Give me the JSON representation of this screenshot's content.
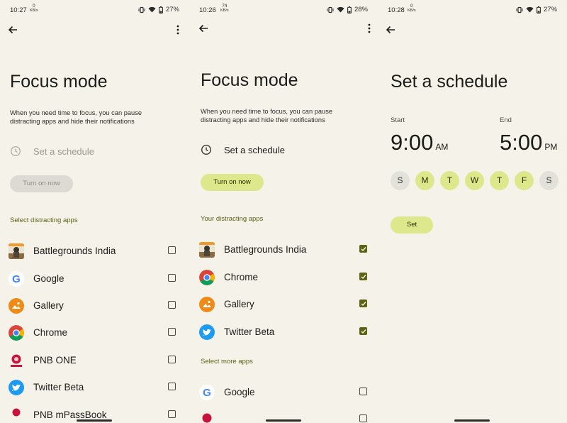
{
  "colors": {
    "background": "#f5f2ea",
    "accent": "#dde88c",
    "accent_text": "#2a2f00",
    "disabled": "#dcdad2",
    "section_text": "#5b6112",
    "checkbox_on": "#5c6312",
    "day_off": "#e3e2da"
  },
  "screen1": {
    "status": {
      "time": "10:27",
      "kb_value": "0",
      "kb_unit": "KB/s",
      "battery": "27%"
    },
    "title": "Focus mode",
    "description": "When you need time to focus, you can pause distracting apps and hide their notifications",
    "schedule_label": "Set a schedule",
    "turn_on_label": "Turn on now",
    "section_label": "Select distracting apps",
    "apps": [
      {
        "name": "Battlegrounds India",
        "checked": false,
        "icon": "battlegrounds-icon"
      },
      {
        "name": "Google",
        "checked": false,
        "icon": "google-icon"
      },
      {
        "name": "Gallery",
        "checked": false,
        "icon": "gallery-icon"
      },
      {
        "name": "Chrome",
        "checked": false,
        "icon": "chrome-icon"
      },
      {
        "name": "PNB ONE",
        "checked": false,
        "icon": "pnb-one-icon"
      },
      {
        "name": "Twitter Beta",
        "checked": false,
        "icon": "twitter-icon"
      },
      {
        "name": "PNB mPassBook",
        "checked": false,
        "icon": "pnb-mpassbook-icon"
      }
    ]
  },
  "screen2": {
    "status": {
      "time": "10:26",
      "kb_value": "74",
      "kb_unit": "KB/s",
      "battery": "28%"
    },
    "title": "Focus mode",
    "description": "When you need time to focus, you can pause distracting apps and hide their notifications",
    "schedule_label": "Set a schedule",
    "turn_on_label": "Turn on now",
    "section_label": "Your distracting apps",
    "apps": [
      {
        "name": "Battlegrounds India",
        "checked": true,
        "icon": "battlegrounds-icon"
      },
      {
        "name": "Chrome",
        "checked": true,
        "icon": "chrome-icon"
      },
      {
        "name": "Gallery",
        "checked": true,
        "icon": "gallery-icon"
      },
      {
        "name": "Twitter Beta",
        "checked": true,
        "icon": "twitter-icon"
      }
    ],
    "more_section_label": "Select more apps",
    "more_apps": [
      {
        "name": "Google",
        "checked": false,
        "icon": "google-icon"
      }
    ]
  },
  "screen3": {
    "status": {
      "time": "10:28",
      "kb_value": "0",
      "kb_unit": "KB/s",
      "battery": "27%"
    },
    "title": "Set a schedule",
    "start_label": "Start",
    "start_time": "9:00",
    "start_ampm": "AM",
    "end_label": "End",
    "end_time": "5:00",
    "end_ampm": "PM",
    "days": [
      {
        "letter": "S",
        "selected": false
      },
      {
        "letter": "M",
        "selected": true
      },
      {
        "letter": "T",
        "selected": true
      },
      {
        "letter": "W",
        "selected": true
      },
      {
        "letter": "T",
        "selected": true
      },
      {
        "letter": "F",
        "selected": true
      },
      {
        "letter": "S",
        "selected": false
      }
    ],
    "set_label": "Set"
  }
}
